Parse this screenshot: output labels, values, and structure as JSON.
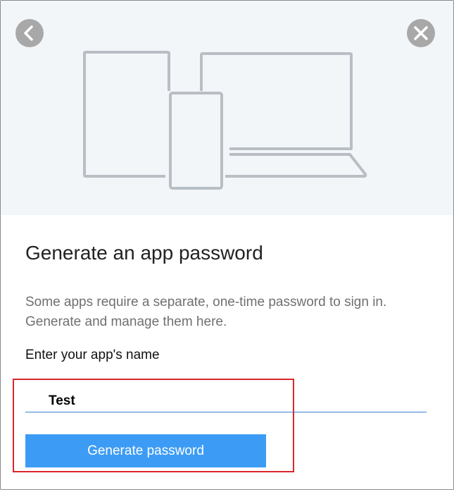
{
  "nav": {
    "back_icon": "chevron-left-icon",
    "close_icon": "close-icon"
  },
  "hero": {
    "illustration": "devices-illustration"
  },
  "content": {
    "title": "Generate an app password",
    "description": "Some apps require a separate, one-time password to sign in. Generate and manage them here.",
    "field_label": "Enter your app's name",
    "app_name_value": "Test",
    "generate_button_label": "Generate password"
  },
  "colors": {
    "accent": "#3c9cf5",
    "hero_background": "#f3f6f9",
    "highlight": "#d9262c",
    "icon_gray": "#a8a8a8"
  }
}
